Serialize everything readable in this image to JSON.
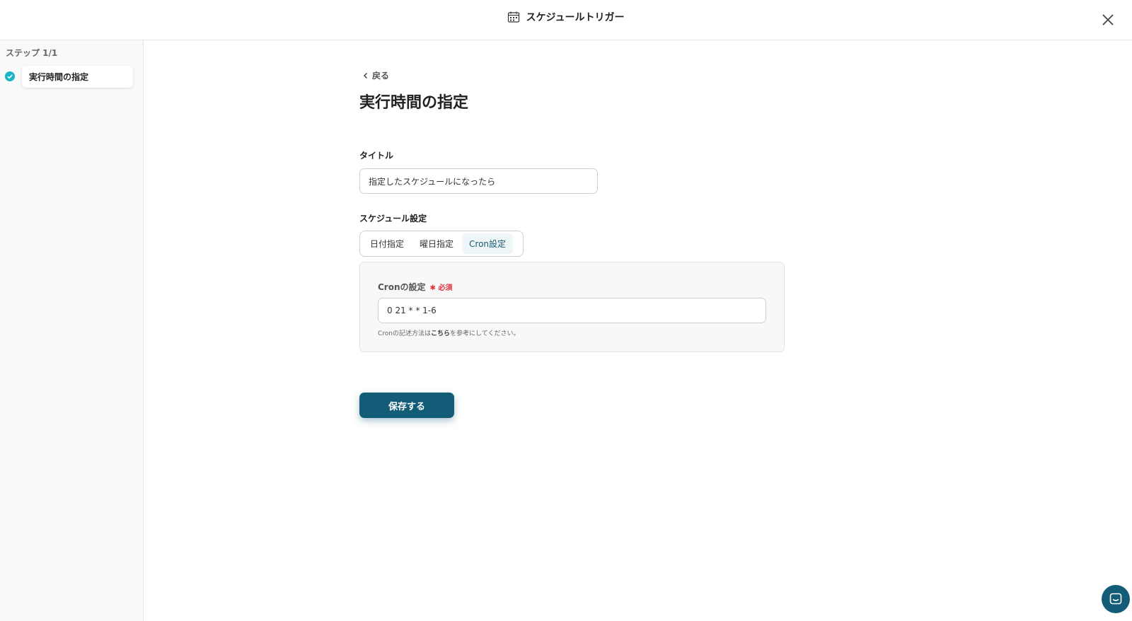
{
  "header": {
    "title": "スケジュールトリガー",
    "icon": "calendar-icon"
  },
  "sidebar": {
    "step_label": "ステップ 1/1",
    "items": [
      {
        "label": "実行時間の指定",
        "status": "completed"
      }
    ]
  },
  "main": {
    "back_label": "戻る",
    "page_title": "実行時間の指定",
    "title_field": {
      "label": "タイトル",
      "value": "指定したスケジュールになったら"
    },
    "schedule": {
      "label": "スケジュール設定",
      "tabs": [
        {
          "label": "日付指定"
        },
        {
          "label": "曜日指定"
        },
        {
          "label": "Cron設定",
          "active": true
        }
      ],
      "cron": {
        "label": "Cronの設定",
        "required": "必須",
        "value": "0 21 * * 1-6",
        "help_prefix": "Cronの記述方法は",
        "help_link": "こちら",
        "help_suffix": "を参考にしてください。"
      }
    },
    "save_label": "保存する"
  },
  "colors": {
    "accent": "#125c78",
    "check": "#1bb5c6",
    "required": "#e0333e"
  }
}
